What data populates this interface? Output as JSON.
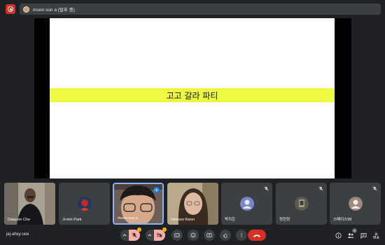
{
  "top": {
    "presenter_label": "moon sun a (발표 중)"
  },
  "slide": {
    "title": "고고 갈라 파티",
    "band_color": "#edfc42"
  },
  "tiles": [
    {
      "name": "Daejoon Che"
    },
    {
      "name": "Ji-min Park"
    },
    {
      "name": "moon sun a"
    },
    {
      "name": "Heesoo Kwon"
    },
    {
      "name": "박지은"
    },
    {
      "name": "정현정"
    },
    {
      "name": "스페이스99"
    }
  ],
  "bottom": {
    "meeting_code": "jej-ahxy-uce",
    "people_count": "8",
    "mic_badge": "!",
    "cam_badge": "!"
  },
  "colors": {
    "accent": "#8ab4f8",
    "end_call": "#d93025",
    "muted_ctrl": "#f6aea9"
  }
}
